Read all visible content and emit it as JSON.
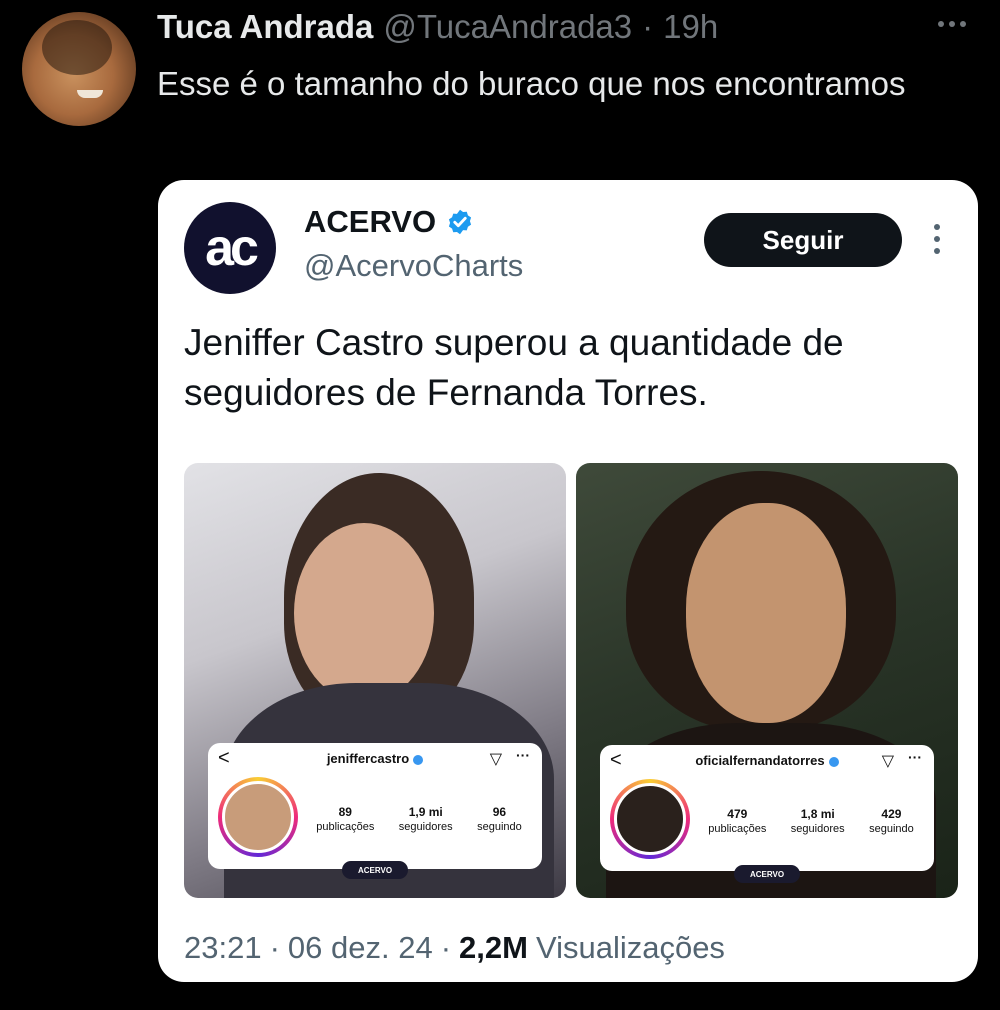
{
  "tweet": {
    "author_name": "Tuca Andrada",
    "author_handle": "@TucaAndrada3",
    "separator": "·",
    "time": "19h",
    "text": "Esse é  o tamanho do buraco que nos encontramos"
  },
  "quoted": {
    "avatar_text": "ac",
    "name": "ACERVO",
    "handle": "@AcervoCharts",
    "follow_label": "Seguir",
    "text": "Jeniffer Castro superou a quantidade de seguidores de Fernanda Torres.",
    "left_profile": {
      "back": "<",
      "username": "jeniffercastro",
      "send": "▽",
      "dots": "···",
      "stats": [
        {
          "value": "89",
          "label": "publicações"
        },
        {
          "value": "1,9 mi",
          "label": "seguidores"
        },
        {
          "value": "96",
          "label": "seguindo"
        }
      ],
      "brand": "ACERVO"
    },
    "right_profile": {
      "back": "<",
      "username": "oficialfernandatorres",
      "send": "▽",
      "dots": "···",
      "stats": [
        {
          "value": "479",
          "label": "publicações"
        },
        {
          "value": "1,8 mi",
          "label": "seguidores"
        },
        {
          "value": "429",
          "label": "seguindo"
        }
      ],
      "brand": "ACERVO"
    },
    "footer": {
      "time": "23:21",
      "sep1": "·",
      "date": "06 dez. 24",
      "sep2": "·",
      "views": "2,2M",
      "views_label": "Visualizações"
    }
  },
  "colors": {
    "background": "#000000",
    "card": "#ffffff",
    "verified": "#1d9bf0",
    "button": "#0f1419"
  },
  "icons": [
    "more-horizontal-icon",
    "verified-badge-icon",
    "more-vertical-icon",
    "back-chevron-icon",
    "send-icon"
  ]
}
